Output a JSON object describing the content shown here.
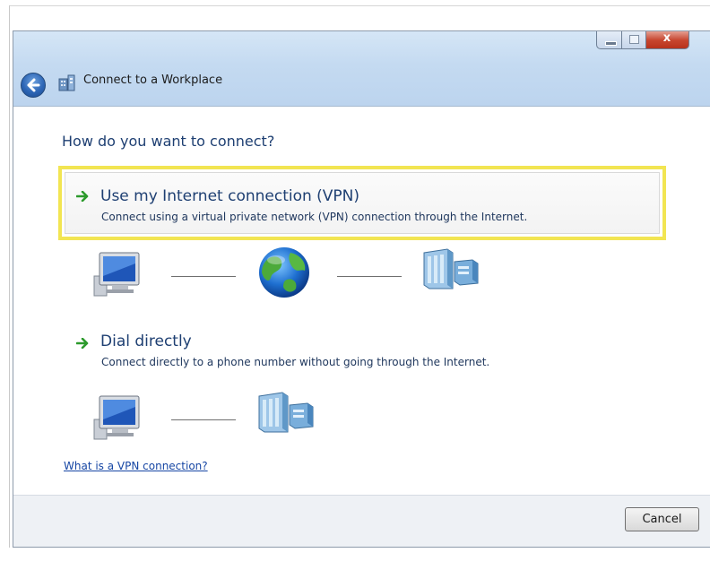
{
  "window": {
    "title": "Connect to a Workplace",
    "close_glyph": "x",
    "icons": [
      "back-arrow-icon",
      "workplace-network-icon",
      "minimize-icon",
      "maximize-icon",
      "close-icon"
    ]
  },
  "main": {
    "heading": "How do you want to connect?",
    "options": [
      {
        "title": "Use my Internet connection (VPN)",
        "description": "Connect using a virtual private network (VPN) connection through the Internet.",
        "highlighted": true,
        "diagram_icons": [
          "computer-icon",
          "globe-icon",
          "server-icon"
        ]
      },
      {
        "title": "Dial directly",
        "description": "Connect directly to a phone number without going through the Internet.",
        "highlighted": false,
        "diagram_icons": [
          "computer-icon",
          "server-icon"
        ]
      }
    ],
    "help_link": "What is a VPN connection?"
  },
  "footer": {
    "cancel_label": "Cancel"
  },
  "colors": {
    "highlight": "#f2e552",
    "heading": "#1e3f72",
    "link": "#1646a4",
    "arrow": "#2c9a2c"
  }
}
